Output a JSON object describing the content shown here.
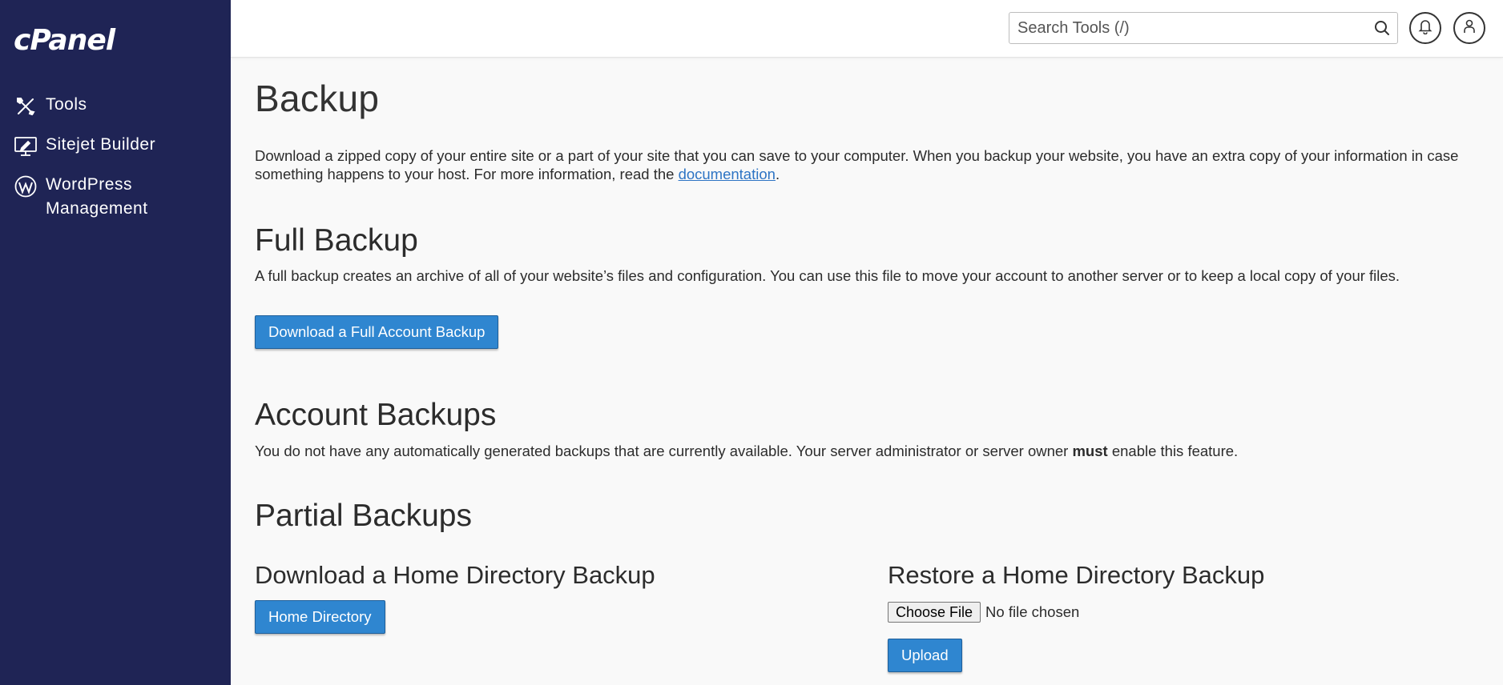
{
  "sidebar": {
    "logo": "cPanel",
    "items": [
      {
        "label": "Tools",
        "icon": "tools-icon"
      },
      {
        "label": "Sitejet Builder",
        "icon": "monitor-edit-icon"
      },
      {
        "label": "WordPress Management",
        "icon": "wordpress-icon"
      }
    ]
  },
  "header": {
    "search_placeholder": "Search Tools (/)",
    "icons": [
      "search-icon",
      "bell-icon",
      "user-icon"
    ]
  },
  "main": {
    "title": "Backup",
    "intro_text": "Download a zipped copy of your entire site or a part of your site that you can save to your computer. When you backup your website, you have an extra copy of your information in case something happens to your host. For more information, read the ",
    "intro_link": "documentation",
    "intro_end": ".",
    "full_backup": {
      "heading": "Full Backup",
      "description": "A full backup creates an archive of all of your website’s files and configuration. You can use this file to move your account to another server or to keep a local copy of your files.",
      "button": "Download a Full Account Backup"
    },
    "account_backups": {
      "heading": "Account Backups",
      "desc_before": "You do not have any automatically generated backups that are currently available. Your server administrator or server owner ",
      "desc_bold": "must",
      "desc_after": " enable this feature."
    },
    "partial_backups": {
      "heading": "Partial Backups",
      "download_heading": "Download a Home Directory Backup",
      "download_button": "Home Directory",
      "restore_heading": "Restore a Home Directory Backup",
      "choose_file": "Choose File",
      "file_status": "No file chosen",
      "upload_button": "Upload"
    }
  },
  "colors": {
    "sidebar_bg": "#1f2455",
    "button_bg": "#2f86d0",
    "link": "#2d74c4"
  }
}
